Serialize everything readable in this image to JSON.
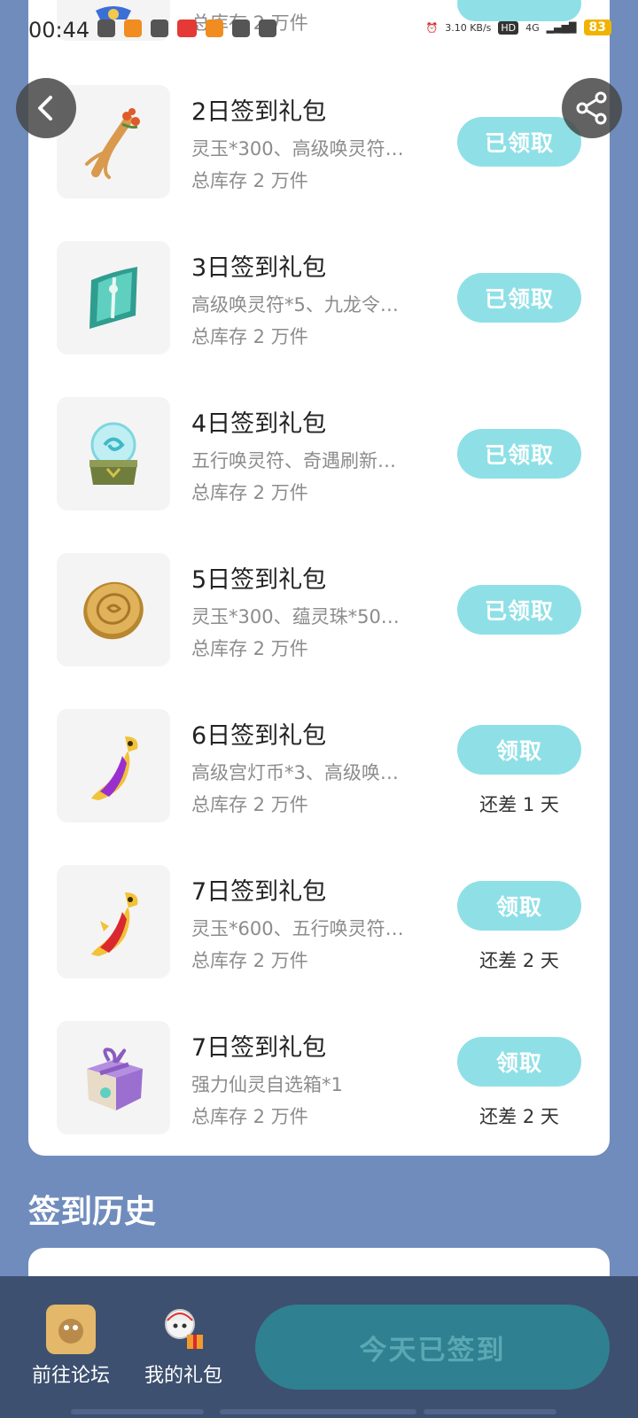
{
  "status": {
    "time": "00:44",
    "net_speed": "3.10 KB/s",
    "hd": "HD",
    "network": "4G",
    "battery": "83",
    "accent": "#f0b400"
  },
  "gifts": [
    {
      "title": "",
      "desc": "",
      "stock": "总库存 2 万件",
      "button": "",
      "remaining": "",
      "icon": "partial-item-icon",
      "claimed": true
    },
    {
      "title": "2日签到礼包",
      "desc": "灵玉*300、高级唤灵符…",
      "stock": "总库存 2 万件",
      "button": "已领取",
      "remaining": "",
      "icon": "ginseng-icon",
      "claimed": true
    },
    {
      "title": "3日签到礼包",
      "desc": "高级唤灵符*5、九龙令…",
      "stock": "总库存 2 万件",
      "button": "已领取",
      "remaining": "",
      "icon": "talisman-icon",
      "claimed": true
    },
    {
      "title": "4日签到礼包",
      "desc": "五行唤灵符、奇遇刷新…",
      "stock": "总库存 2 万件",
      "button": "已领取",
      "remaining": "",
      "icon": "crystal-orb-icon",
      "claimed": true
    },
    {
      "title": "5日签到礼包",
      "desc": "灵玉*300、蕴灵珠*50…",
      "stock": "总库存 2 万件",
      "button": "已领取",
      "remaining": "",
      "icon": "gold-coin-icon",
      "claimed": true
    },
    {
      "title": "6日签到礼包",
      "desc": "高级宫灯币*3、高级唤…",
      "stock": "总库存 2 万件",
      "button": "领取",
      "remaining": "还差 1 天",
      "icon": "purple-ruyi-icon",
      "claimed": false
    },
    {
      "title": "7日签到礼包",
      "desc": "灵玉*600、五行唤灵符…",
      "stock": "总库存 2 万件",
      "button": "领取",
      "remaining": "还差 2 天",
      "icon": "red-ruyi-icon",
      "claimed": false
    },
    {
      "title": "7日签到礼包",
      "desc": "强力仙灵自选箱*1",
      "stock": "总库存 2 万件",
      "button": "领取",
      "remaining": "还差 2 天",
      "icon": "gift-box-icon",
      "claimed": false
    }
  ],
  "history": {
    "title": "签到历史"
  },
  "bottom": {
    "forum_label": "前往论坛",
    "gifts_label": "我的礼包",
    "signed_label": "今天已签到"
  }
}
